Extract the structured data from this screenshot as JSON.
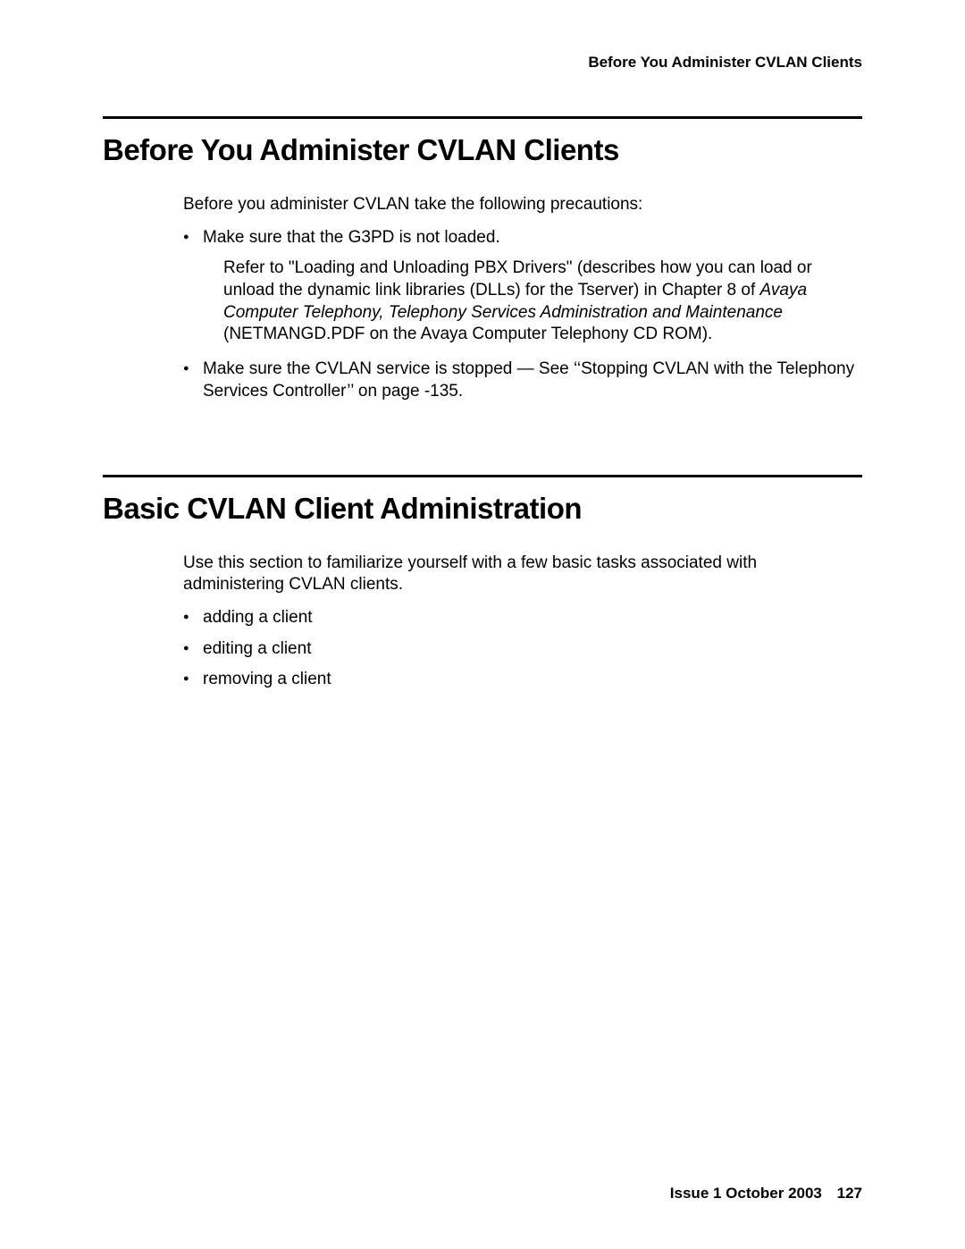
{
  "header": {
    "running_title": "Before You Administer CVLAN Clients"
  },
  "section1": {
    "heading": "Before You Administer CVLAN Clients",
    "intro": "Before you administer CVLAN take the following precautions:",
    "bullet1": "Make sure that the G3PD is not loaded.",
    "sub_before_italic": "Refer to \"Loading and Unloading PBX Drivers\" (describes how you can load or unload the dynamic link libraries (DLLs) for the Tserver) in Chapter 8 of ",
    "sub_italic": "Avaya Computer Telephony, Telephony Services Administration and Maintenance",
    "sub_after_italic": " (NETMANGD.PDF on the Avaya Computer Telephony CD ROM).",
    "bullet2": "Make sure the CVLAN service is stopped — See ‘‘Stopping CVLAN with the Telephony Services Controller’’ on page -135."
  },
  "section2": {
    "heading": "Basic CVLAN Client Administration",
    "intro": "Use this section to familiarize yourself with a few basic tasks associated with administering CVLAN clients.",
    "bullet1": "adding a client",
    "bullet2": "editing a client",
    "bullet3": "removing a client"
  },
  "footer": {
    "issue_text": "Issue 1   October 2003",
    "page_number": "127"
  }
}
